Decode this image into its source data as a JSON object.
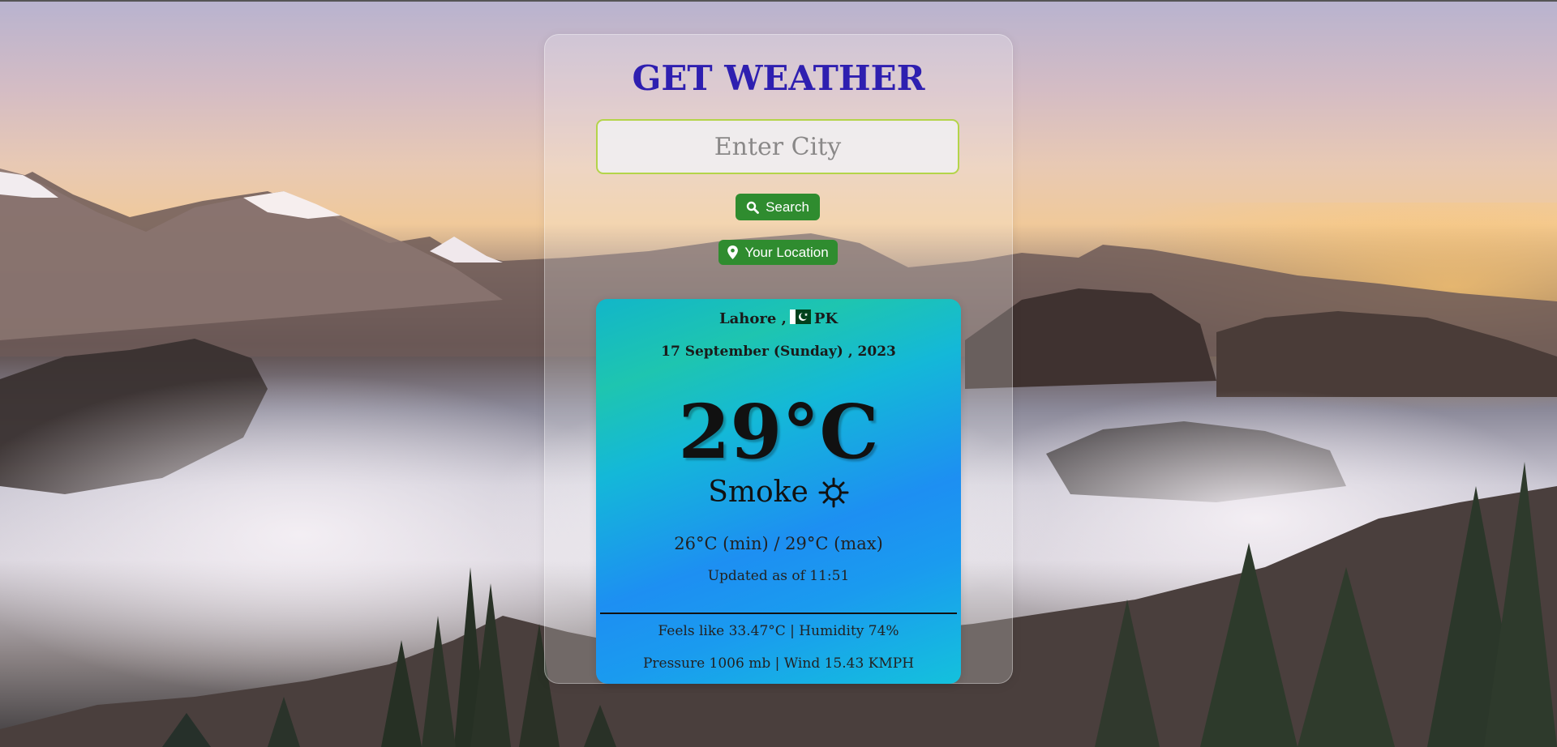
{
  "app": {
    "title": "GET WEATHER"
  },
  "search": {
    "placeholder": "Enter City",
    "value": "",
    "search_label": "Search",
    "search_icon": "search-icon",
    "location_label": "Your Location",
    "location_icon": "map-pin-icon"
  },
  "weather": {
    "city": "Lahore ,",
    "country": "PK",
    "flag_icon": "pakistan-flag-icon",
    "date": "17 September (Sunday) , 2023",
    "temperature": "29°C",
    "condition": "Smoke",
    "condition_icon": "sun-icon",
    "min_max": "26°C (min) / 29°C (max)",
    "updated": "Updated as of 11:51",
    "feels_humidity": "Feels like 33.47°C | Humidity 74%",
    "pressure_wind": "Pressure 1006 mb | Wind 15.43 KMPH"
  },
  "colors": {
    "title": "#2e1fb0",
    "button": "#2f8c2f",
    "input_border": "#b4d44a"
  }
}
